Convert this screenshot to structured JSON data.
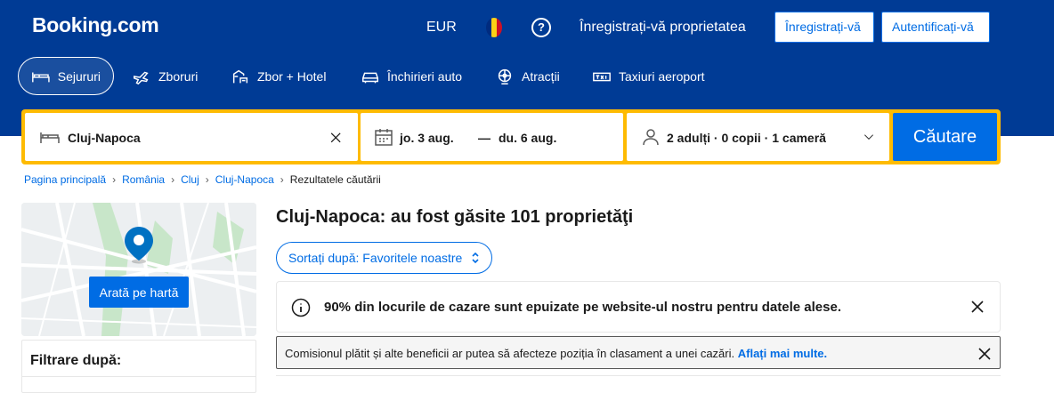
{
  "header": {
    "logo": "Booking.com",
    "currency": "EUR",
    "flag_colors": [
      "#002b7f",
      "#fcd116",
      "#ce1126"
    ],
    "help_icon": "question-circle-icon",
    "list_property": "Înregistrați-vă proprietatea",
    "register": "Înregistrați-vă",
    "login": "Autentificați-vă",
    "background": "#003b95"
  },
  "nav": {
    "tabs": [
      {
        "label": "Sejururi",
        "icon": "bed-icon",
        "active": true
      },
      {
        "label": "Zboruri",
        "icon": "plane-icon",
        "active": false
      },
      {
        "label": "Zbor + Hotel",
        "icon": "plane-hotel-icon",
        "active": false
      },
      {
        "label": "Închirieri auto",
        "icon": "car-icon",
        "active": false
      },
      {
        "label": "Atracții",
        "icon": "attractions-icon",
        "active": false
      },
      {
        "label": "Taxiuri aeroport",
        "icon": "taxi-icon",
        "active": false
      }
    ]
  },
  "search": {
    "destination": "Cluj-Napoca",
    "checkin": "jo. 3 aug.",
    "dash": "—",
    "checkout": "du. 6 aug.",
    "guests": "2 adulți · 0 copii · 1 cameră",
    "button": "Căutare",
    "accent": "#febb02"
  },
  "breadcrumb": {
    "items": [
      "Pagina principală",
      "România",
      "Cluj",
      "Cluj-Napoca"
    ],
    "current": "Rezultatele căutării"
  },
  "map": {
    "button": "Arată pe hartă"
  },
  "filters": {
    "title": "Filtrare după:"
  },
  "results": {
    "title": "Cluj-Napoca: au fost găsite 101 proprietăţi",
    "sort": "Sortați după: Favoritele noastre",
    "alert": "90% din locurile de cazare sunt epuizate pe website-ul nostru pentru datele alese.",
    "notice_text": "Comisionul plătit și alte beneficii ar putea să afecteze poziția în clasament a unei cazări.",
    "notice_link": "Aflați mai multe."
  },
  "colors": {
    "primary": "#006ce4",
    "header": "#003b95"
  }
}
